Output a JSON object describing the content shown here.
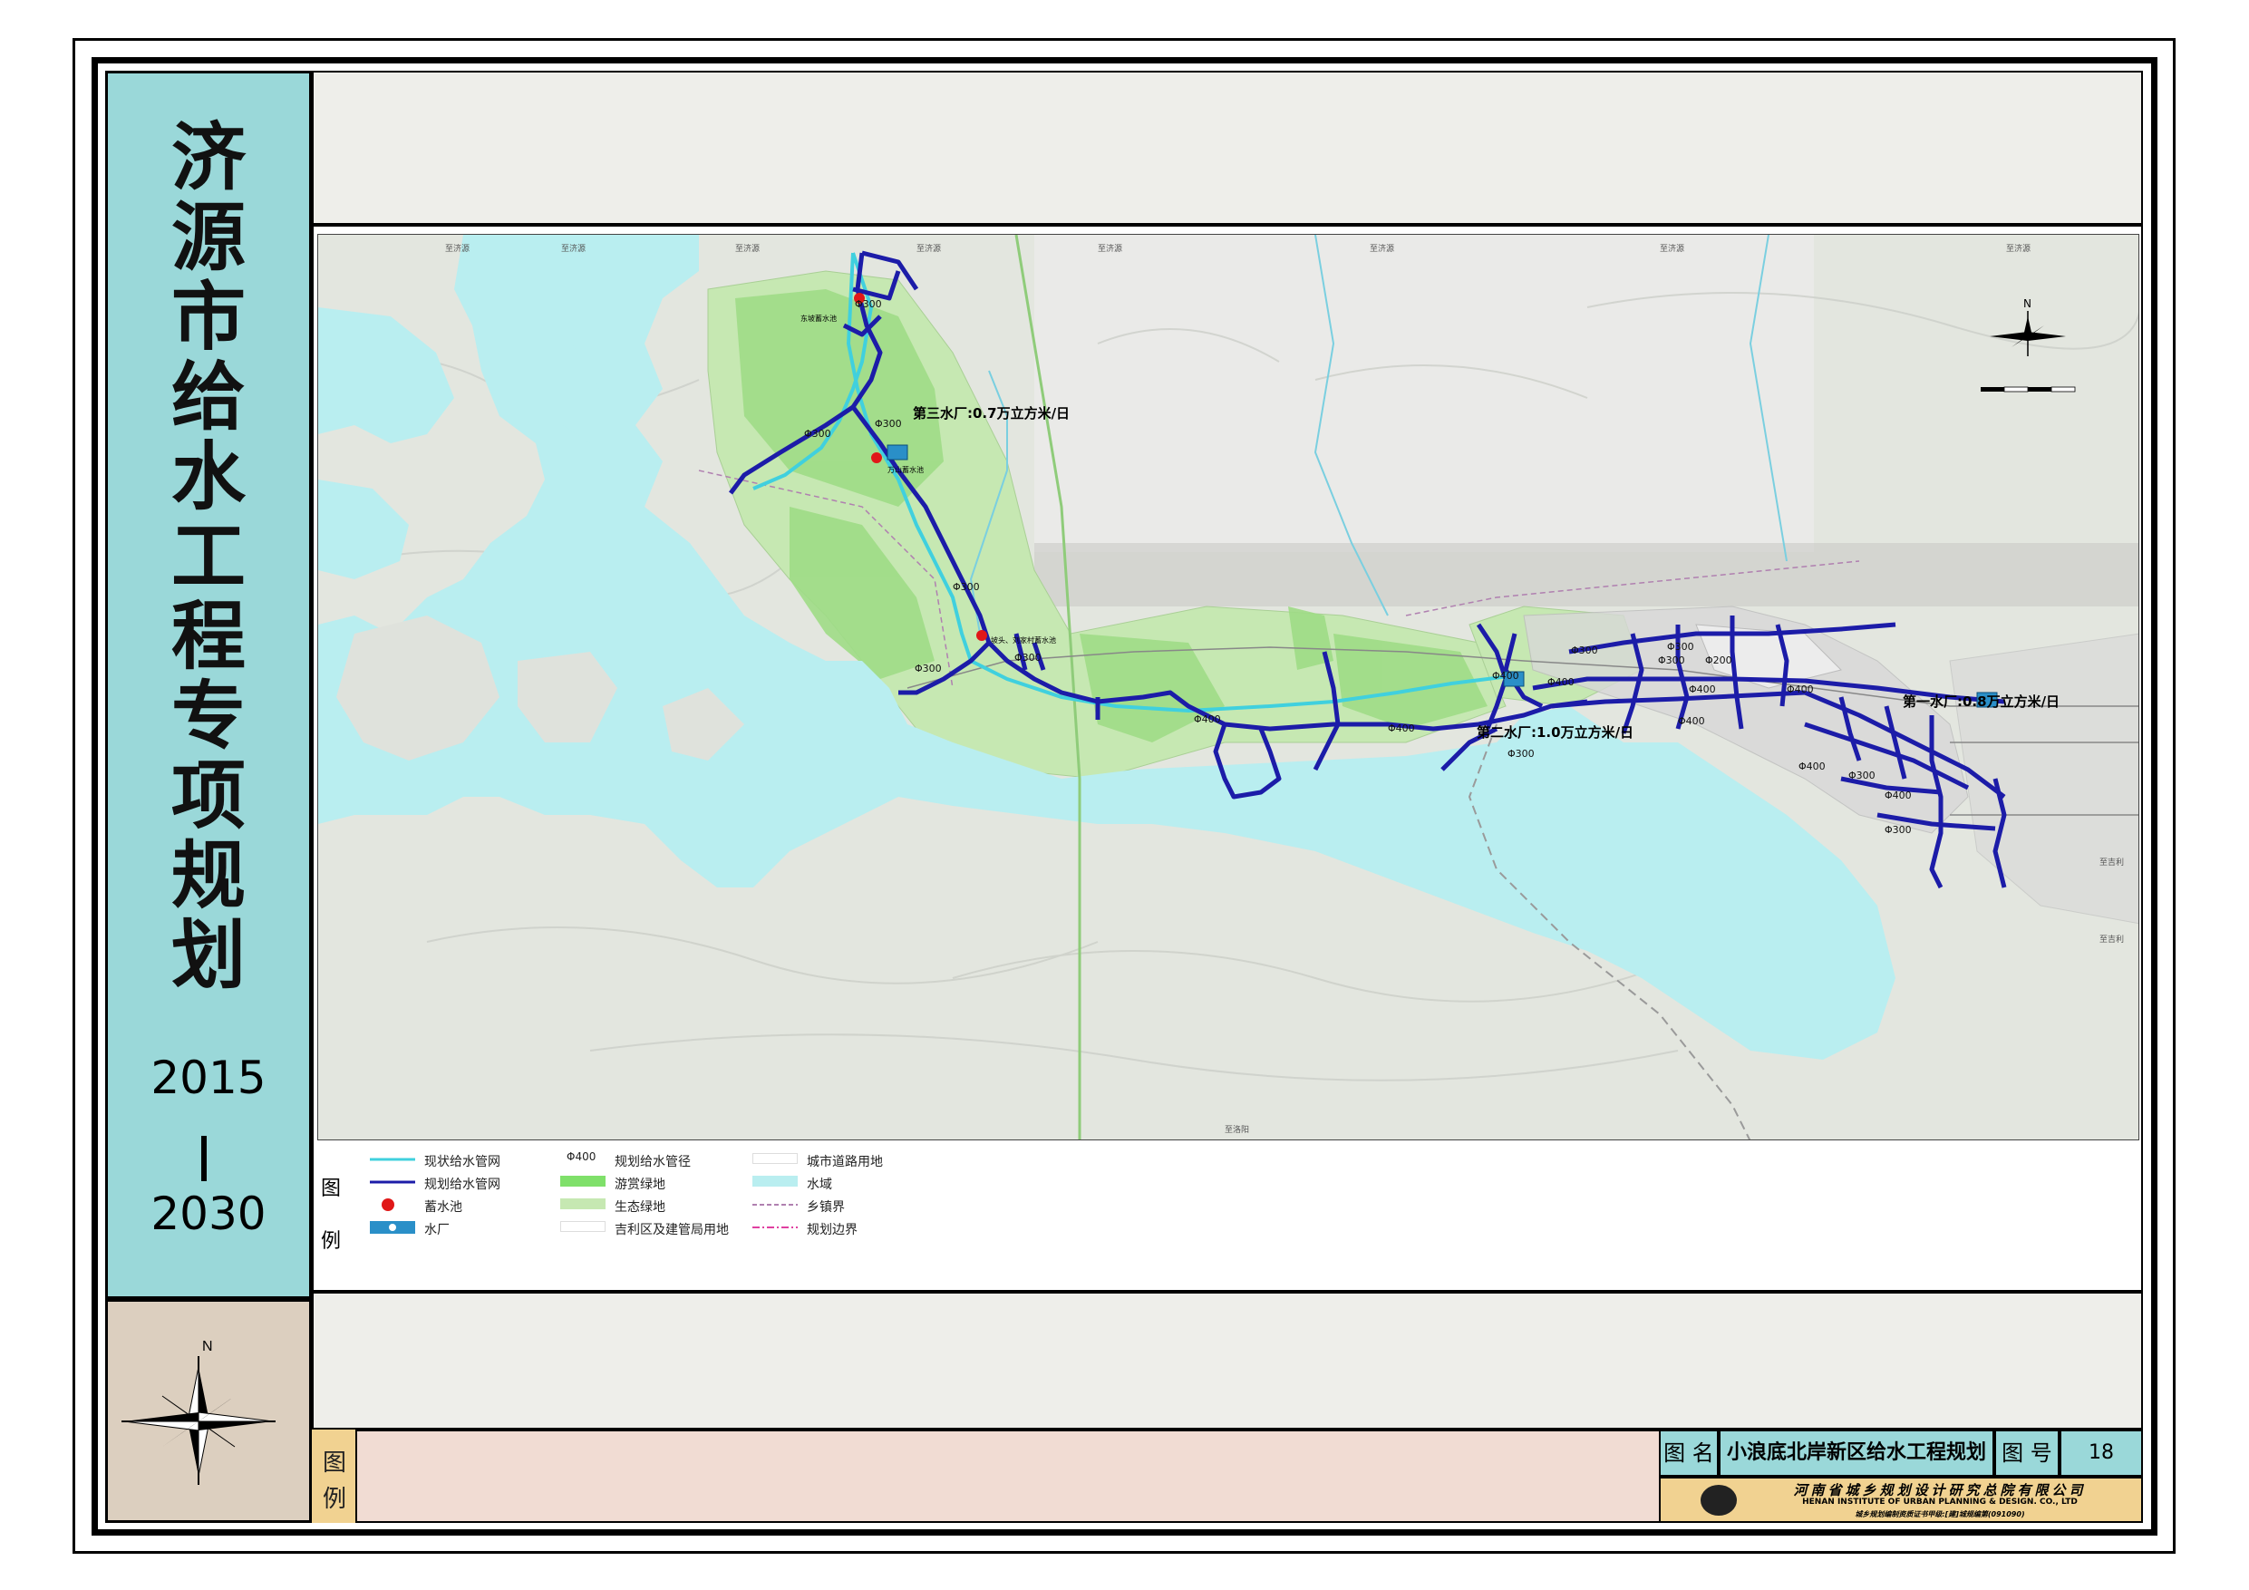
{
  "sidebar": {
    "title_chars": [
      "济",
      "源",
      "市",
      "给",
      "水",
      "工",
      "程",
      "专",
      "项",
      "规",
      "划"
    ],
    "year_start": "2015",
    "year_end": "2030"
  },
  "map": {
    "north_symbol": "N",
    "plants": [
      {
        "label": "第三水厂:0.7万立方米/日"
      },
      {
        "label": "第二水厂:1.0万立方米/日"
      },
      {
        "label": "第一水厂:0.8万立方米/日"
      }
    ],
    "reservoir_labels": [
      "东坡蓄水池",
      "万山蓄水池",
      "坡头、刘家村蓄水池"
    ],
    "pipe_labels": [
      "Φ300",
      "Φ300",
      "Φ300",
      "Φ300",
      "Φ300",
      "Φ300",
      "Φ400",
      "Φ400",
      "Φ400",
      "Φ400",
      "Φ300",
      "Φ300",
      "Φ200",
      "Φ400",
      "Φ300",
      "Φ400",
      "Φ400",
      "Φ400",
      "Φ300",
      "Φ400",
      "Φ300",
      "Φ300"
    ],
    "edge_labels": [
      "至济源",
      "至济源",
      "至济源",
      "至济源",
      "至济源",
      "至济源",
      "至济源",
      "至济源",
      "至吉利",
      "至吉利",
      "至洛阳"
    ],
    "colors": {
      "water": "#b9eef0",
      "ecology_green": "#c6e8b2",
      "tourism_green": "#9fdc86",
      "terrain": "#e3e6df",
      "existing_pipe": "#40d0de",
      "planned_pipe": "#1c1ca8",
      "reservoir": "#e01818",
      "plant": "#2a8fc8"
    }
  },
  "legend": {
    "heading_chars": [
      "图",
      "例"
    ],
    "items": [
      {
        "label": "现状给水管网",
        "symbol": "existing-pipe-line",
        "color": "#40d0de"
      },
      {
        "label": "规划给水管网",
        "symbol": "planned-pipe-line",
        "color": "#1c1ca8"
      },
      {
        "label": "蓄水池",
        "symbol": "reservoir-dot-icon",
        "color": "#e01818"
      },
      {
        "label": "水厂",
        "symbol": "water-plant-icon",
        "color": "#2a8fc8"
      },
      {
        "label": "规划给水管径",
        "symbol_text": "Φ400"
      },
      {
        "label": "游赏绿地",
        "symbol": "green-swatch",
        "color": "#7fe06a"
      },
      {
        "label": "生态绿地",
        "symbol": "green-swatch",
        "color": "#c6e8b2"
      },
      {
        "label": "吉利区及建管局用地",
        "symbol": "white-swatch",
        "color": "#ffffff"
      },
      {
        "label": "城市道路用地",
        "symbol": "white-swatch",
        "color": "#ffffff"
      },
      {
        "label": "水域",
        "symbol": "water-swatch",
        "color": "#b9eef0"
      },
      {
        "label": "乡镇界",
        "symbol": "township-boundary-line",
        "color": "#b080b0"
      },
      {
        "label": "规划边界",
        "symbol": "planning-boundary-line",
        "color": "#e040a0"
      }
    ]
  },
  "bottom_bar": {
    "legend_chars": [
      "图",
      "例"
    ]
  },
  "title_block": {
    "name_label": "图 名",
    "name": "小浪底北岸新区给水工程规划图",
    "number_label": "图 号",
    "number": "18",
    "institute_cn": "河南省城乡规划设计研究总院有限公司",
    "institute_en": "HENAN INSTITUTE OF URBAN PLANNING & DESIGN. CO., LTD",
    "certificate": "城乡规划编制资质证书甲级:[建]城规编第(091090)"
  },
  "compass": {
    "north": "N"
  }
}
